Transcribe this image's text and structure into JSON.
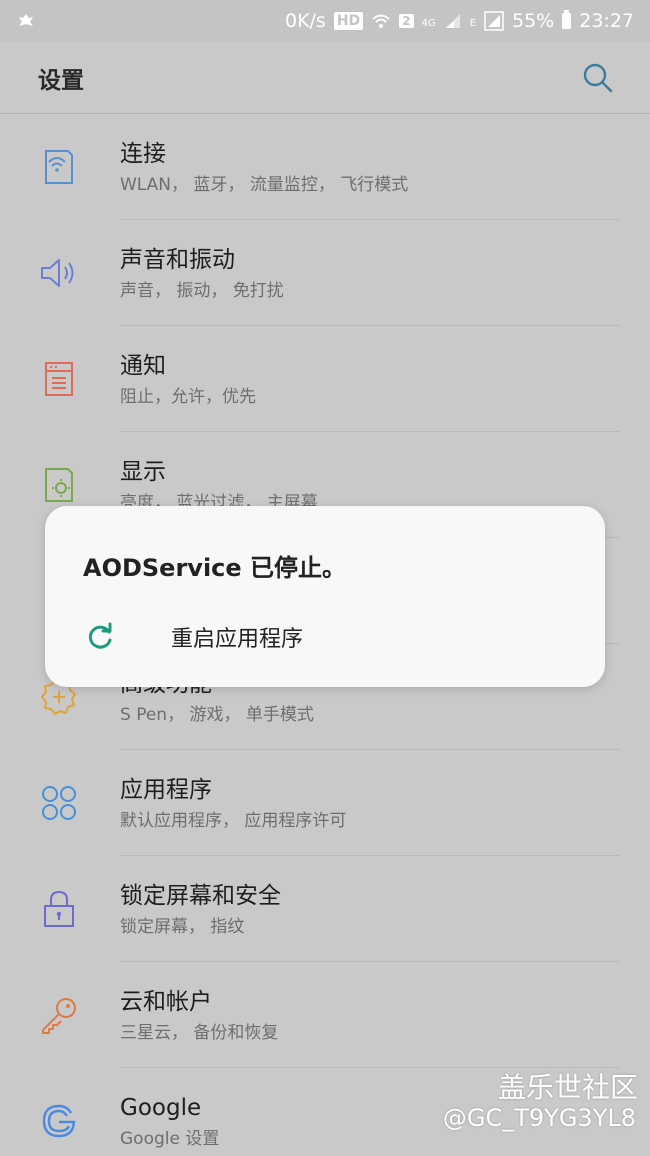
{
  "status_bar": {
    "speed": "0K/s",
    "hd": "HD",
    "sim": "2",
    "net_4g": "4G",
    "net_e": "E",
    "battery_pct": "55%",
    "time": "23:27"
  },
  "header": {
    "title": "设置",
    "search_icon": "search-icon"
  },
  "settings_items": [
    {
      "label": "连接",
      "sub": "WLAN， 蓝牙， 流量监控， 飞行模式",
      "icon": "connections-icon",
      "color": "#5a8fcf"
    },
    {
      "label": "声音和振动",
      "sub": "声音， 振动， 免打扰",
      "icon": "speaker-icon",
      "color": "#6b7fd6"
    },
    {
      "label": "通知",
      "sub": "阻止，允许，优先",
      "icon": "notification-icon",
      "color": "#e06a58"
    },
    {
      "label": "显示",
      "sub": "亮度， 蓝光过滤， 主屏幕",
      "icon": "display-icon",
      "color": "#7aa84c"
    },
    {
      "label": "",
      "sub": "",
      "icon": "",
      "color": ""
    },
    {
      "label": "高级功能",
      "sub": "S Pen， 游戏， 单手模式",
      "icon": "advanced-features-icon",
      "color": "#e0a23a"
    },
    {
      "label": "应用程序",
      "sub": "默认应用程序， 应用程序许可",
      "icon": "apps-icon",
      "color": "#4a90d9"
    },
    {
      "label": "锁定屏幕和安全",
      "sub": "锁定屏幕， 指纹",
      "icon": "lock-icon",
      "color": "#6d6ad0"
    },
    {
      "label": "云和帐户",
      "sub": "三星云， 备份和恢复",
      "icon": "key-icon",
      "color": "#e07a45"
    },
    {
      "label": "Google",
      "sub": "Google 设置",
      "icon": "google-icon",
      "color": "#4a8ae0"
    }
  ],
  "dialog": {
    "title": "AODService 已停止。",
    "restart_label": "重启应用程序",
    "accent": "#1f9a7f"
  },
  "watermark": {
    "line1": "盖乐世社区",
    "line2": "@GC_T9YG3YL8"
  }
}
